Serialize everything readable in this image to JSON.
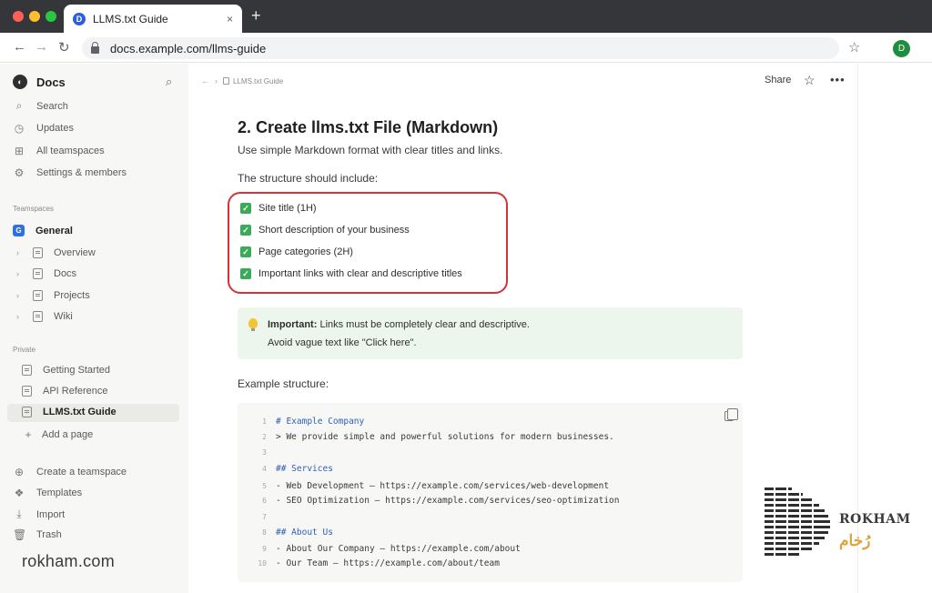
{
  "browser": {
    "tab_title": "LLMS.txt Guide",
    "tab_favicon": "D",
    "tab_close": "×",
    "new_tab": "+",
    "url": "docs.example.com/llms-guide",
    "profile_initial": "D"
  },
  "sidebar": {
    "workspace": {
      "logo": "◐",
      "name": "Docs"
    },
    "top_items": [
      {
        "icon": "search-icon",
        "label": "Search"
      },
      {
        "icon": "clock-icon",
        "label": "Updates"
      },
      {
        "icon": "grid-icon",
        "label": "All teamspaces"
      },
      {
        "icon": "gear-icon",
        "label": "Settings & members"
      }
    ],
    "teamspaces_title": "Teamspaces",
    "teamspace": {
      "badge": "G",
      "name": "General"
    },
    "teamspace_pages": [
      {
        "label": "Overview"
      },
      {
        "label": "Docs"
      },
      {
        "label": "Projects"
      },
      {
        "label": "Wiki"
      }
    ],
    "private_title": "Private",
    "private_pages": [
      {
        "label": "Getting Started"
      },
      {
        "label": "API Reference"
      },
      {
        "label": "LLMS.txt Guide",
        "active": true
      }
    ],
    "add_page": "Add a page",
    "bottom_items": [
      {
        "icon": "plus-circle-icon",
        "label": "Create a teamspace"
      },
      {
        "icon": "templates-icon",
        "label": "Templates"
      },
      {
        "icon": "import-icon",
        "label": "Import"
      },
      {
        "icon": "trash-icon",
        "label": "Trash"
      }
    ]
  },
  "topbar": {
    "breadcrumb": "LLMS.txt Guide",
    "share": "Share",
    "more": "•••"
  },
  "content": {
    "heading": "2. Create llms.txt File (Markdown)",
    "intro": "Use simple Markdown format with clear titles and links.",
    "structure_intro": "The structure should include:",
    "checklist": [
      "Site title (1H)",
      "Short description of your business",
      "Page categories (2H)",
      "Important links with clear and descriptive titles"
    ],
    "callout": {
      "bold": "Important:",
      "line1": " Links must be completely clear and descriptive.",
      "line2": "Avoid vague text like \"Click here\"."
    },
    "example_label": "Example structure:",
    "code_lines": [
      {
        "n": "1",
        "text": "# Example Company",
        "kw": true
      },
      {
        "n": "2",
        "text": "> We provide simple and powerful solutions for modern businesses."
      },
      {
        "n": "3",
        "text": ""
      },
      {
        "n": "4",
        "text": "## Services",
        "kw": true
      },
      {
        "n": "5",
        "text": "- Web Development – https://example.com/services/web-development"
      },
      {
        "n": "6",
        "text": "- SEO Optimization – https://example.com/services/seo-optimization"
      },
      {
        "n": "7",
        "text": ""
      },
      {
        "n": "8",
        "text": "## About Us",
        "kw": true
      },
      {
        "n": "9",
        "text": "- About Our Company – https://example.com/about"
      },
      {
        "n": "10",
        "text": "- Our Team – https://example.com/about/team"
      }
    ]
  },
  "watermark": {
    "site": "rokham.com",
    "brand_en": "ROKHAM",
    "brand_fa": "رُخام"
  },
  "colors": {
    "highlight_border": "#d0343a",
    "check_green": "#3bab5a",
    "callout_bg": "#edf6ec",
    "code_keyword": "#2f5fb8",
    "teamspace_badge": "#2f6fe4"
  }
}
